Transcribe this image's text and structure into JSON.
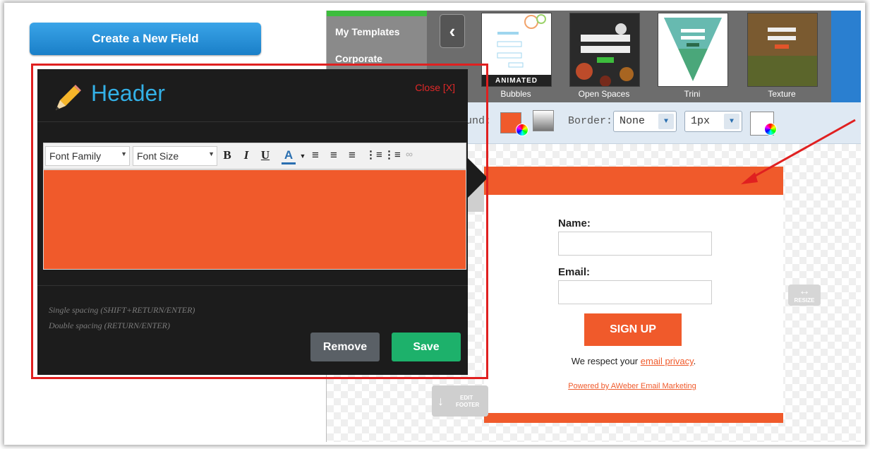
{
  "left": {
    "create_button": "Create a New Field"
  },
  "gallery": {
    "sidebar_items": [
      "My Templates",
      "Corporate"
    ],
    "back_icon": "chevron-left-icon",
    "badge": "ANIMATED",
    "templates": [
      "Bubbles",
      "Open Spaces",
      "Trini",
      "Texture"
    ]
  },
  "stylebar": {
    "background_label_partial": "ound:",
    "border_label": "Border:",
    "border_style": "None",
    "border_width": "1px",
    "background_color": "#f05a2b"
  },
  "editor": {
    "title": "Header",
    "close": "Close [X]",
    "font_family": "Font Family",
    "font_size": "Font Size",
    "toolbar": {
      "bold": "B",
      "italic": "I",
      "underline": "U",
      "font_color": "A"
    },
    "area_color": "#f05a2b",
    "hint_single": "Single spacing (SHIFT+RETURN/ENTER)",
    "hint_double": "Double spacing (RETURN/ENTER)",
    "remove": "Remove",
    "save": "Save"
  },
  "form": {
    "name_label": "Name:",
    "email_label": "Email:",
    "submit": "SIGN UP",
    "respect_text": "We respect your",
    "respect_link": "email privacy",
    "respect_end": ".",
    "powered": "Powered by AWeber Email Marketing"
  },
  "controls": {
    "resize": "RESIZE",
    "edit_footer_line1": "EDIT",
    "edit_footer_line2": "FOOTER"
  },
  "colors": {
    "accent_orange": "#f05a2b",
    "highlight_red": "#e02020",
    "save_green": "#1db16b",
    "title_blue": "#33b0e6"
  }
}
